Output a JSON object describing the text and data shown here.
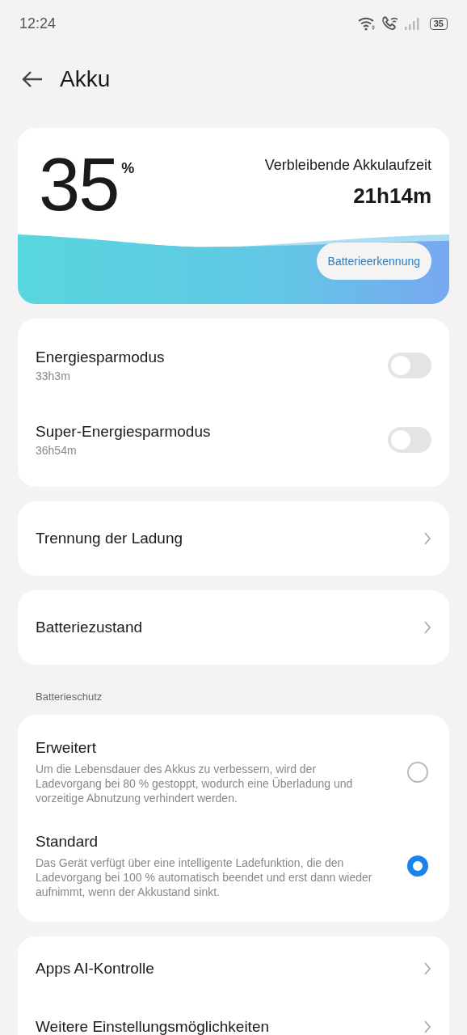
{
  "status_bar": {
    "time": "12:24",
    "battery": "35"
  },
  "header": {
    "title": "Akku"
  },
  "battery_card": {
    "percent": "35",
    "unit": "%",
    "remaining_label": "Verbleibende Akkulaufzeit",
    "remaining": "21h14m",
    "button": "Batterieerkennung"
  },
  "saver_modes": [
    {
      "label": "Energiesparmodus",
      "sub": "33h3m",
      "on": false
    },
    {
      "label": "Super-Energiesparmodus",
      "sub": "36h54m",
      "on": false
    }
  ],
  "links_1": [
    "Trennung der Ladung"
  ],
  "links_2": [
    "Batteriezustand"
  ],
  "protection": {
    "heading": "Batterieschutz",
    "options": [
      {
        "label": "Erweitert",
        "description": "Um die Lebensdauer des Akkus zu verbessern, wird der Ladevorgang bei 80 % gestoppt, wodurch eine Überladung und vorzeitige Abnutzung verhindert werden.",
        "selected": false
      },
      {
        "label": "Standard",
        "description": "Das Gerät verfügt über eine intelligente Ladefunktion, die den Ladevorgang bei 100 % automatisch beendet und erst dann wieder aufnimmt, wenn der Akkustand sinkt.",
        "selected": true
      }
    ]
  },
  "links_3": [
    "Apps AI-Kontrolle",
    "Weitere Einstellungsmöglichkeiten"
  ]
}
